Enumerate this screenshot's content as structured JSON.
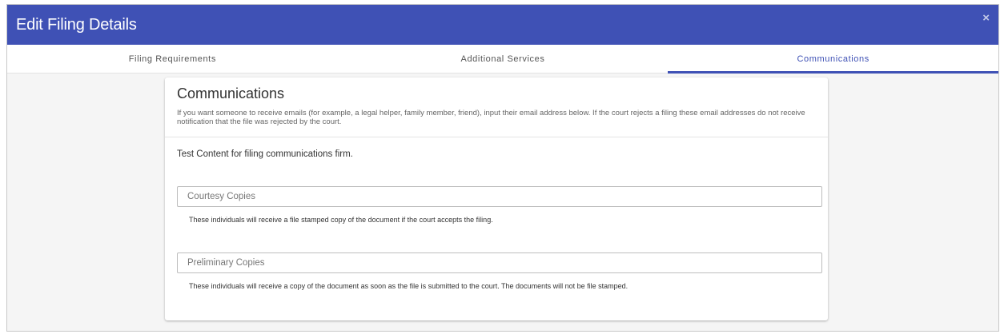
{
  "header": {
    "title": "Edit Filing Details",
    "close_label": "×"
  },
  "tabs": [
    {
      "label": "Filing Requirements"
    },
    {
      "label": "Additional Services"
    },
    {
      "label": "Communications",
      "active": true
    }
  ],
  "card": {
    "title": "Communications",
    "description": "If you want someone to receive emails (for example, a legal helper, family member, friend), input their email address below. If the court rejects a filing these email addresses do not receive notification that the file was rejected by the court.",
    "test_content": "Test Content for filing communications firm.",
    "courtesy": {
      "placeholder": "Courtesy Copies",
      "hint": "These individuals will receive a file stamped copy of the document if the court accepts the filing."
    },
    "preliminary": {
      "placeholder": "Preliminary Copies",
      "hint": "These individuals will receive a copy of the document as soon as the file is submitted to the court. The documents will not be file stamped."
    }
  },
  "colors": {
    "accent": "#3f51b5",
    "background": "#f5f5f5"
  }
}
